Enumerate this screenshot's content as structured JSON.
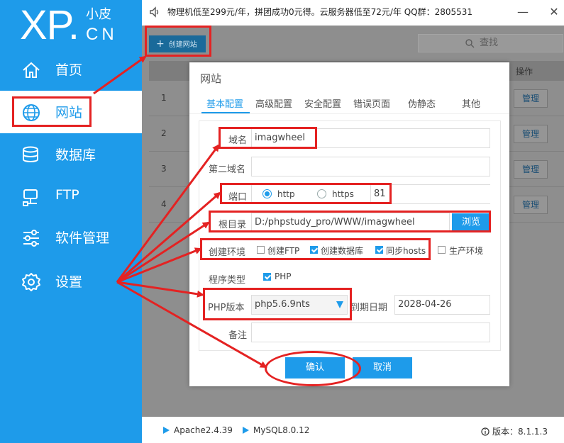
{
  "logo": {
    "main": "XP.",
    "sub_cn": "小皮",
    "sub_en": "CN"
  },
  "sidebar": {
    "items": [
      {
        "label": "首页",
        "icon": "home-icon"
      },
      {
        "label": "网站",
        "icon": "globe-icon",
        "active": true
      },
      {
        "label": "数据库",
        "icon": "database-icon"
      },
      {
        "label": "FTP",
        "icon": "ftp-icon"
      },
      {
        "label": "软件管理",
        "icon": "sliders-icon"
      },
      {
        "label": "设置",
        "icon": "gear-icon"
      }
    ]
  },
  "topbar": {
    "notice": "物理机低至299元/年，拼团成功0元得。云服务器低至72元/年  QQ群：2805531"
  },
  "toolbar": {
    "create_label": "创建网站",
    "search_placeholder": "查找"
  },
  "table": {
    "header_op": "操作",
    "rows": [
      {
        "num": "1",
        "action": "管理"
      },
      {
        "num": "2",
        "action": "管理"
      },
      {
        "num": "3",
        "action": "管理"
      },
      {
        "num": "4",
        "action": "管理"
      }
    ]
  },
  "modal": {
    "title": "网站",
    "tabs": [
      "基本配置",
      "高级配置",
      "安全配置",
      "错误页面",
      "伪静态",
      "其他"
    ],
    "form": {
      "domain_label": "域名",
      "domain_value": "imagwheel",
      "second_domain_label": "第二域名",
      "port_label": "端口",
      "http_label": "http",
      "https_label": "https",
      "port_value": "81",
      "root_label": "根目录",
      "root_value": "D:/phpstudy_pro/WWW/imagwheel",
      "browse_label": "浏览",
      "env_label": "创建环境",
      "env_ftp": "创建FTP",
      "env_db": "创建数据库",
      "env_hosts": "同步hosts",
      "env_prod": "生产环境",
      "program_type_label": "程序类型",
      "program_php": "PHP",
      "php_version_label": "PHP版本",
      "php_version_value": "php5.6.9nts",
      "expire_label": "到期日期",
      "expire_value": "2028-04-26",
      "note_label": "备注"
    },
    "confirm_label": "确认",
    "cancel_label": "取消"
  },
  "footer": {
    "apache": "Apache2.4.39",
    "mysql": "MySQL8.0.12",
    "version": "版本：8.1.1.3"
  },
  "colors": {
    "accent": "#1e9bea",
    "annotation": "#e42222"
  }
}
